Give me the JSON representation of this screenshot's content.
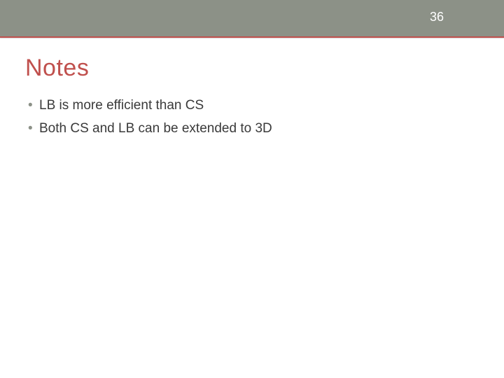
{
  "page_number": "36",
  "title": "Notes",
  "bullets": [
    "LB is more efficient than CS",
    "Both CS and LB can be extended to 3D"
  ],
  "bullet_marker": "•"
}
